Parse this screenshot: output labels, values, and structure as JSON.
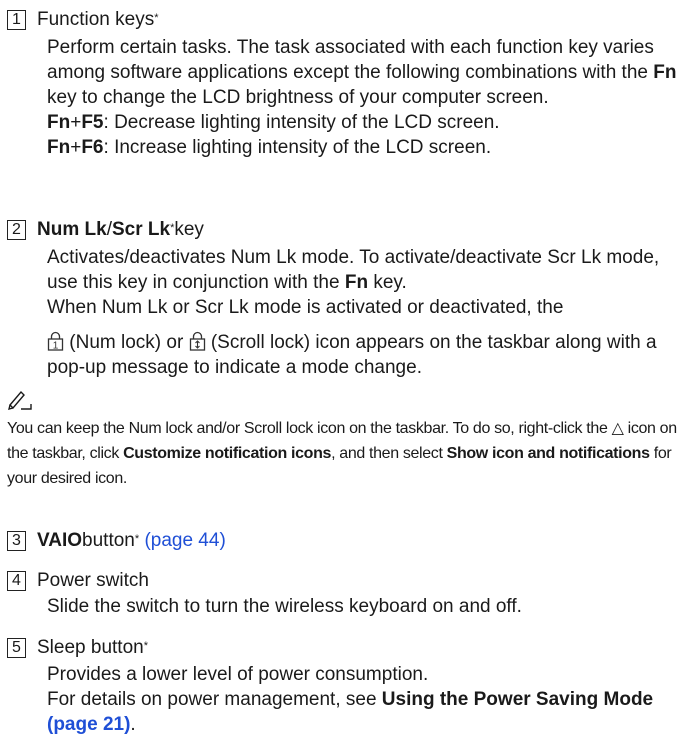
{
  "item1": {
    "num": "1",
    "title": "Function keys",
    "star": "*",
    "desc": "Perform certain tasks. The task associated with each function key varies among software applications except the following combinations with the ",
    "fn": "Fn",
    "desc_end": " key to change the LCD brightness of your computer screen.",
    "line1_key_a": "Fn",
    "plus": "+",
    "line1_key_b": "F5",
    "line1_text": ": Decrease lighting intensity of the LCD screen.",
    "line2_key_a": "Fn",
    "line2_key_b": "F6",
    "line2_text": ": Increase lighting intensity of the LCD screen."
  },
  "item2": {
    "num": "2",
    "title_a": "Num Lk",
    "slash": "/",
    "title_b": "Scr Lk",
    "star": "*",
    "title_end": " key",
    "desc": "Activates/deactivates Num Lk mode. To activate/deactivate Scr Lk mode, use this key in conjunction with the ",
    "fn": "Fn",
    "desc_end": " key.",
    "line2": "When Num Lk or Scr Lk mode is activated or deactivated, the",
    "num_lock": " (Num lock) or ",
    "scroll_lock": " (Scroll lock) icon appears on the taskbar along with a pop-up message to indicate a mode change."
  },
  "note": {
    "text_a": "You can keep the Num lock and/or Scroll lock icon on the taskbar. To do so, right-click the △ icon on the taskbar, click ",
    "customize": "Customize notification icons",
    "text_b": ", and then select ",
    "show": "Show icon and notifications",
    "text_c": " for your desired icon."
  },
  "item3": {
    "num": "3",
    "title": "VAIO",
    "title_end": " button",
    "star": "*",
    "link": "(page 44)"
  },
  "item4": {
    "num": "4",
    "title": "Power switch",
    "desc": "Slide the switch to turn the wireless keyboard on and off."
  },
  "item5": {
    "num": "5",
    "title": "Sleep button",
    "star": "*",
    "desc": "Provides a lower level of power consumption.",
    "desc2": "For details on power management, see ",
    "bold": "Using the Power Saving Mode",
    "link": "(page 21)",
    "end": "."
  }
}
